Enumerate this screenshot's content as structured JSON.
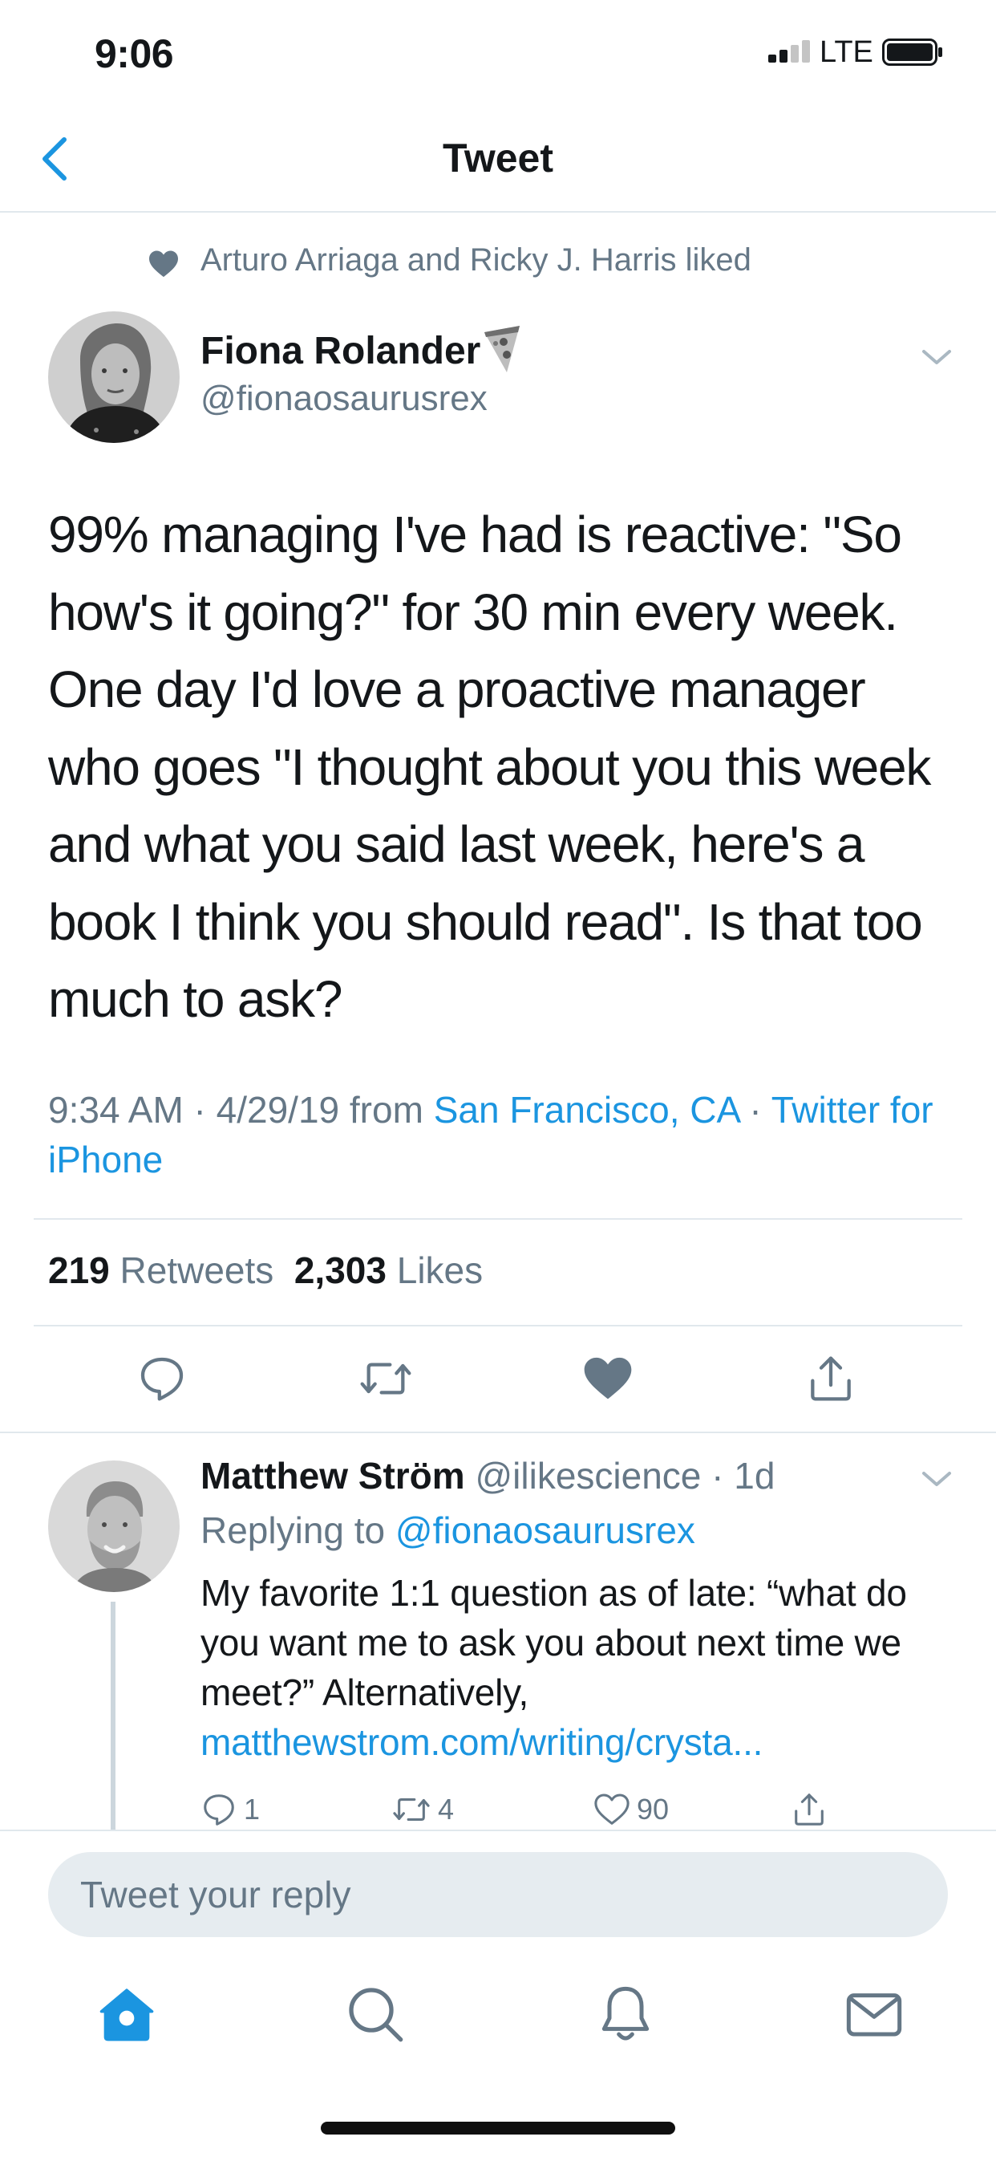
{
  "status_bar": {
    "time": "9:06",
    "network": "LTE"
  },
  "nav": {
    "title": "Tweet",
    "back_icon": "chevron-left-icon"
  },
  "social_context": {
    "text": "Arturo Arriaga and Ricky J. Harris liked",
    "icon": "heart-icon"
  },
  "tweet": {
    "author_name": "Fiona Rolander",
    "author_emoji": "pizza-emoji",
    "author_handle": "@fionaosaurusrex",
    "body": "99% managing I've had is reactive: \"So how's it going?\" for 30 min every week. One day I'd love a proactive manager who goes \"I thought about you this week and what you said last week, here's a book I think you should read\". Is that too much to ask?",
    "time_date": "9:34 AM · 4/29/19 from ",
    "location": "San Francisco, CA",
    "separator": " · ",
    "source": "Twitter for iPhone",
    "retweets_count": "219",
    "retweets_label": "Retweets",
    "likes_count": "2,303",
    "likes_label": "Likes",
    "liked": true
  },
  "reply": {
    "author_name": "Matthew Ström",
    "author_handle": "@ilikescience",
    "age": "· 1d",
    "replying_prefix": "Replying to ",
    "replying_to": "@fionaosaurusrex",
    "body": "My favorite 1:1 question as of late: “what do you want me to ask you about next time we meet?” Alternatively, ",
    "link": "matthewstrom.com/writing/crysta...",
    "reply_count": "1",
    "retweet_count": "4",
    "like_count": "90"
  },
  "composer": {
    "placeholder": "Tweet your reply"
  },
  "colors": {
    "accent": "#1b95e0",
    "text_primary": "#14171a",
    "text_secondary": "#657786",
    "divider": "#e1e8ed",
    "input_bg": "#e6ecf0"
  }
}
